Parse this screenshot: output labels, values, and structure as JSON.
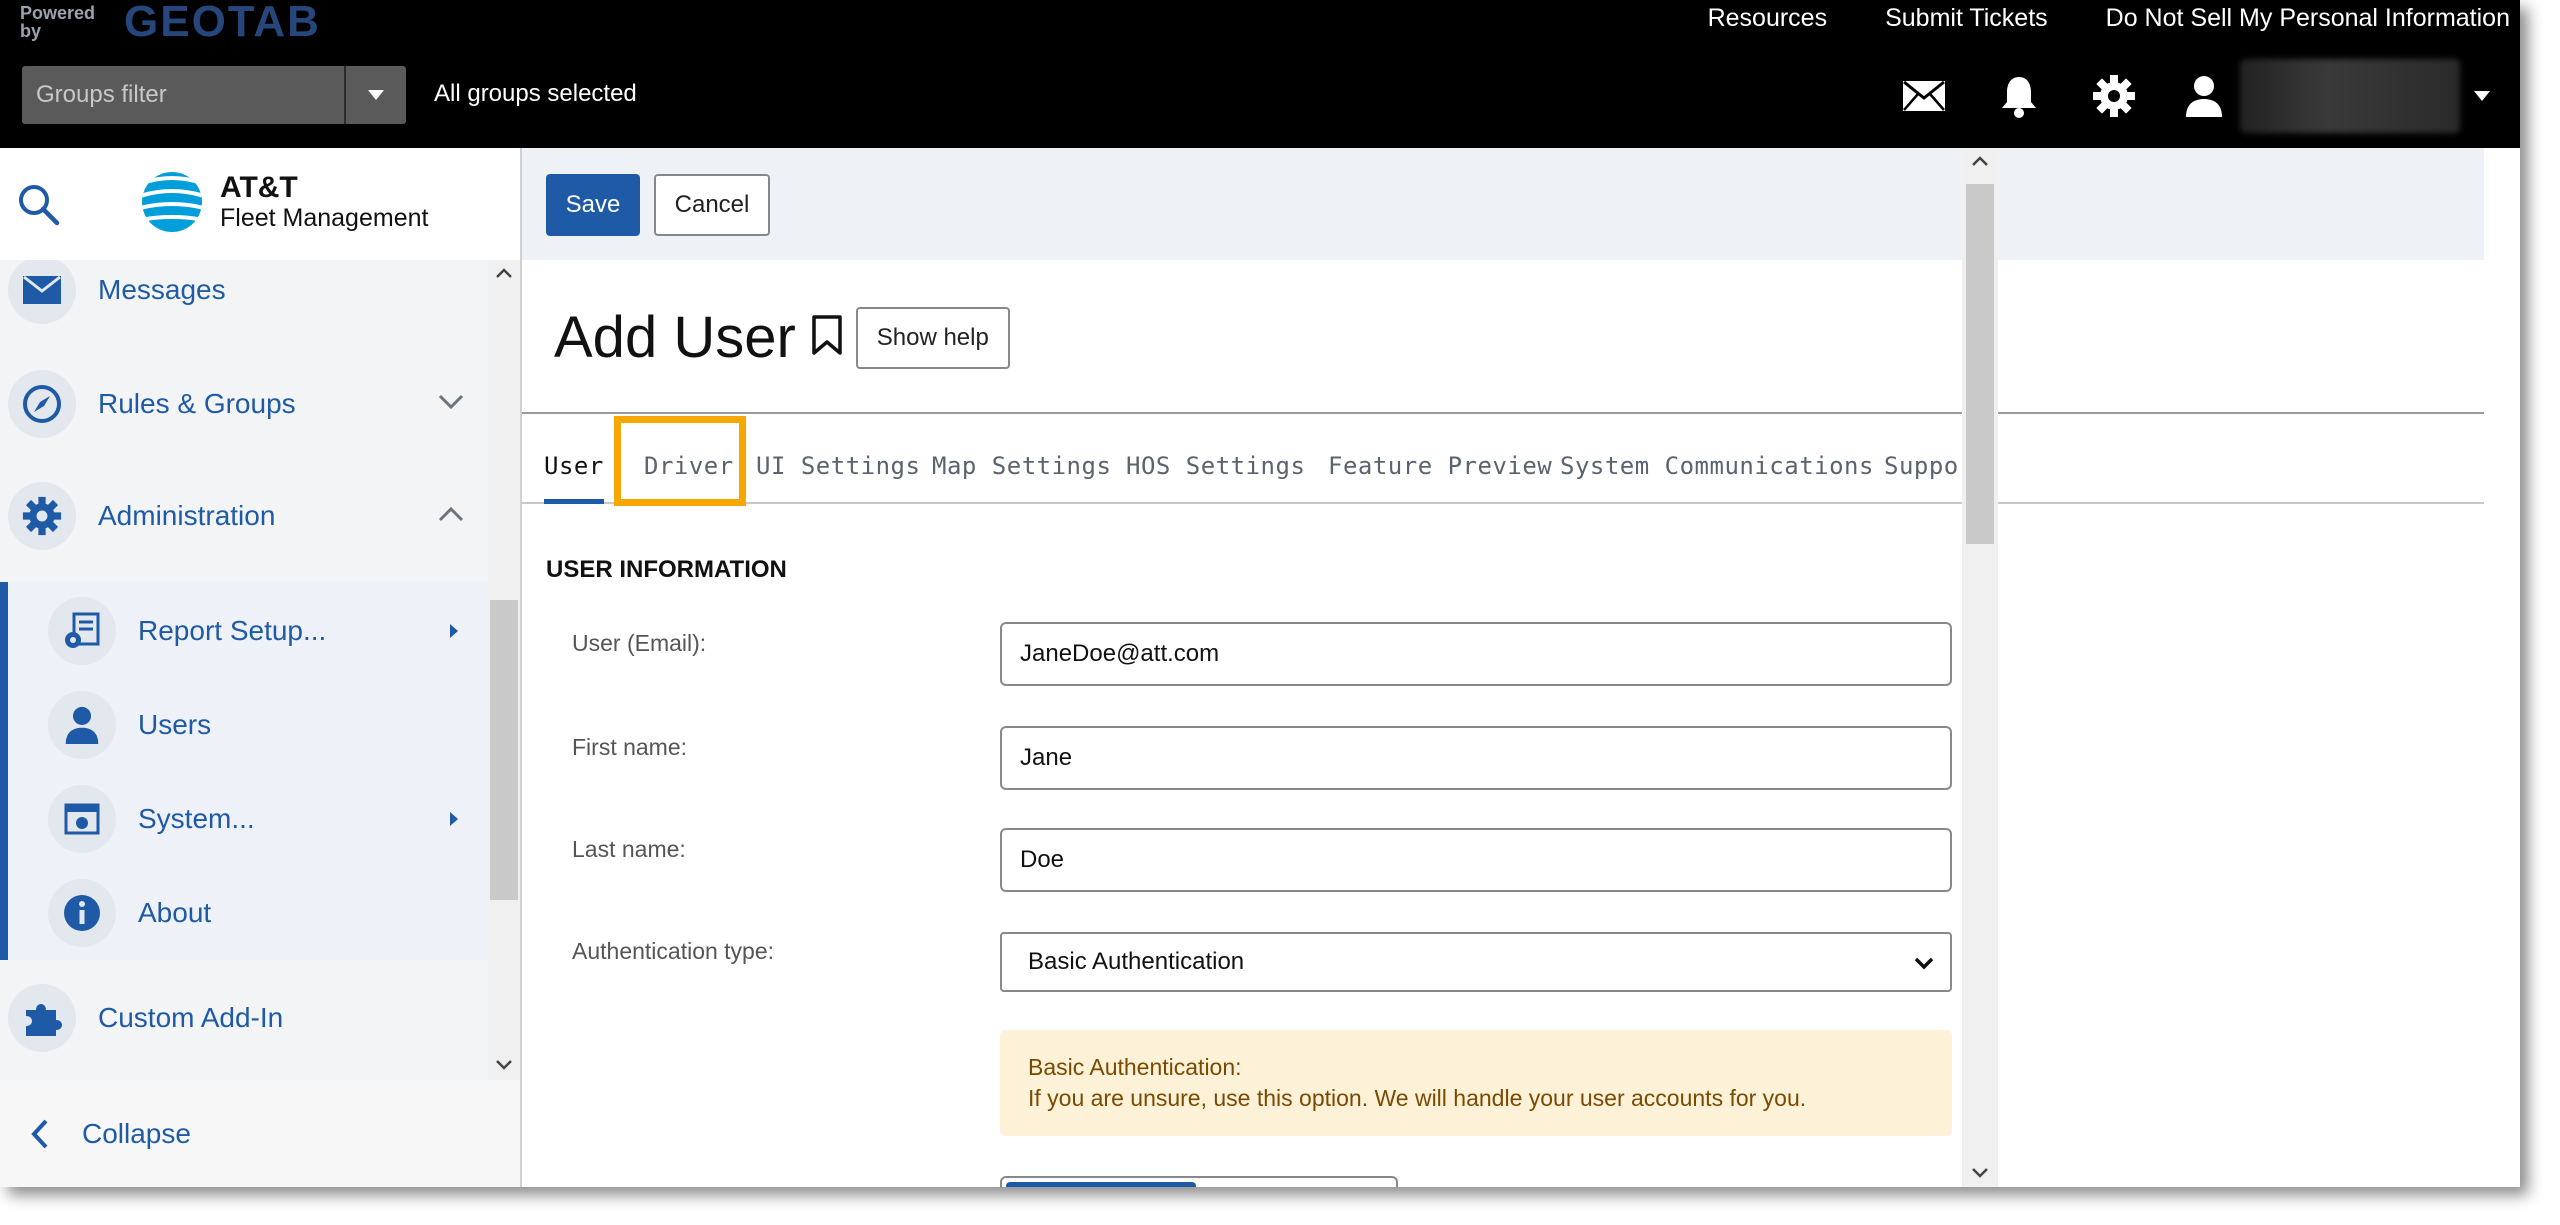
{
  "topbar": {
    "powered_by": "Powered by",
    "brand": "GEOTAB",
    "links": [
      "Resources",
      "Submit Tickets",
      "Do Not Sell My Personal Information"
    ],
    "groups_filter_placeholder": "Groups filter",
    "all_groups": "All groups selected"
  },
  "sidebar": {
    "logo_title": "AT&T",
    "logo_subtitle": "Fleet Management",
    "items": [
      {
        "label": "Messages"
      },
      {
        "label": "Rules & Groups"
      },
      {
        "label": "Administration"
      }
    ],
    "sub_items": [
      {
        "label": "Report Setup..."
      },
      {
        "label": "Users"
      },
      {
        "label": "System..."
      },
      {
        "label": "About"
      }
    ],
    "custom_addin": "Custom Add-In",
    "collapse": "Collapse"
  },
  "toolbar": {
    "save_label": "Save",
    "cancel_label": "Cancel"
  },
  "page": {
    "title": "Add User",
    "help_label": "Show help",
    "tabs": [
      "User",
      "Driver",
      "UI Settings",
      "Map Settings",
      "HOS Settings",
      "Feature Preview",
      "System Communications",
      "Support"
    ],
    "active_tab": "User",
    "highlighted_tab": "Driver",
    "section_title": "USER INFORMATION"
  },
  "form": {
    "email_label": "User (Email):",
    "email_value": "JaneDoe@att.com",
    "first_label": "First name:",
    "first_value": "Jane",
    "last_label": "Last name:",
    "last_value": "Doe",
    "auth_label": "Authentication type:",
    "auth_value": "Basic Authentication",
    "auth_info_title": "Basic Authentication:",
    "auth_info_text": "If you are unsure, use this option. We will handle your user accounts for you."
  },
  "colors": {
    "accent": "#1f5aa6",
    "highlight": "#f6a800",
    "info_bg": "#fdf1d8"
  }
}
